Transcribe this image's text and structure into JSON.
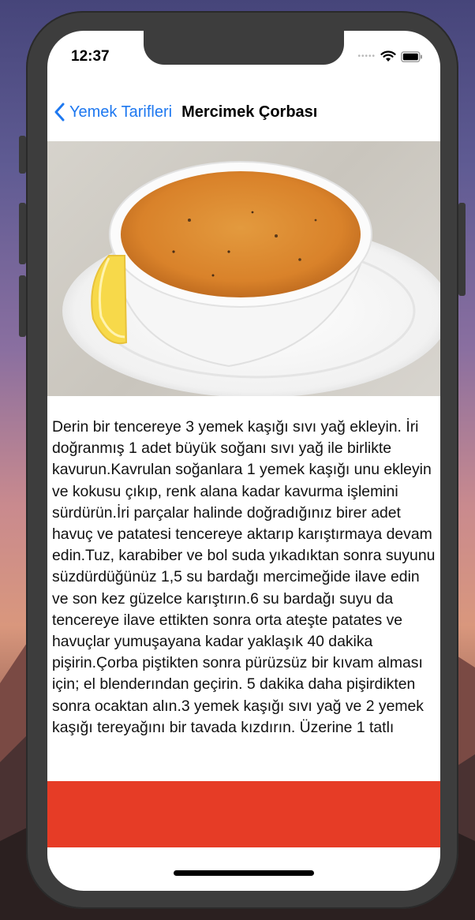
{
  "status_bar": {
    "time": "12:37",
    "signal_icon": "signal-dots-icon",
    "wifi_icon": "wifi-icon",
    "battery_icon": "battery-icon"
  },
  "nav": {
    "back_label": "Yemek Tarifleri",
    "title": "Mercimek Çorbası"
  },
  "hero_image": {
    "description_icon": "soup-bowl-image"
  },
  "recipe": {
    "text": "Derin bir tencereye 3 yemek kaşığı sıvı yağ ekleyin. İri doğranmış 1 adet büyük soğanı sıvı yağ ile birlikte kavurun.Kavrulan soğanlara 1 yemek kaşığı unu ekleyin ve kokusu çıkıp, renk alana kadar kavurma işlemini sürdürün.İri parçalar halinde doğradığınız birer adet havuç ve patatesi tencereye aktarıp karıştırmaya devam edin.Tuz, karabiber ve bol suda yıkadıktan sonra suyunu süzdürdüğünüz 1,5 su bardağı mercimeğide ilave edin ve son kez güzelce karıştırın.6 su bardağı suyu da tencereye ilave ettikten sonra orta ateşte patates ve havuçlar yumuşayana kadar yaklaşık 40 dakika pişirin.Çorba piştikten sonra pürüzsüz bir kıvam alması için; el blenderından geçirin. 5 dakika daha pişirdikten sonra ocaktan alın.3 yemek kaşığı sıvı yağ ve 2 yemek kaşığı tereyağını bir tavada kızdırın. Üzerine 1 tatlı"
  },
  "colors": {
    "accent_blue": "#1e78f0",
    "banner_red": "#e63c26",
    "phone_frame": "#3d3d3d"
  }
}
